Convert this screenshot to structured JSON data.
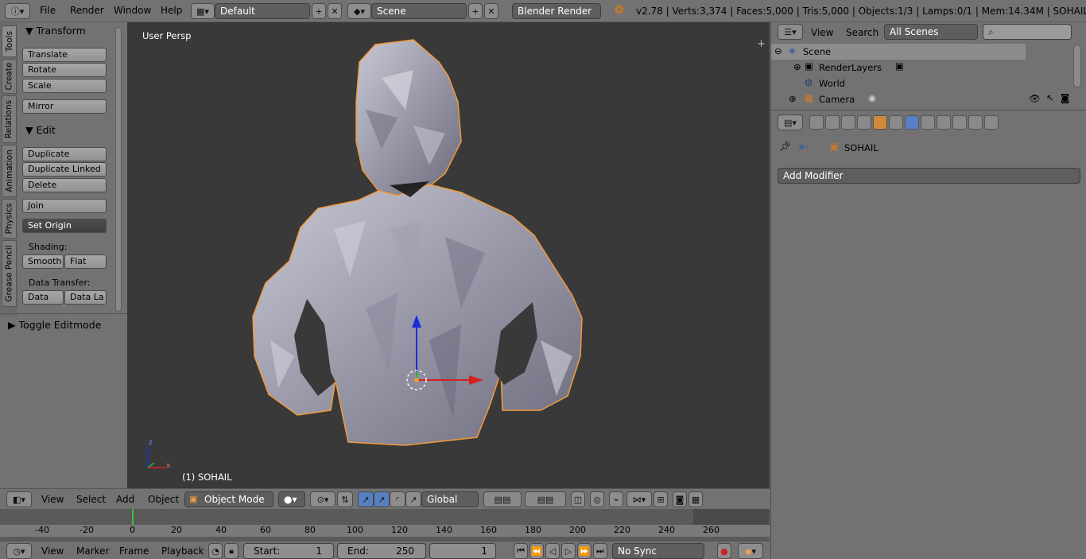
{
  "topbar": {
    "menus": [
      "File",
      "Render",
      "Window",
      "Help"
    ],
    "layout": "Default",
    "scene": "Scene",
    "engine": "Blender Render",
    "stats": "v2.78 | Verts:3,374 | Faces:5,000 | Tris:5,000 | Objects:1/3 | Lamps:0/1 | Mem:14.34M | SOHAIL"
  },
  "tabs": [
    "Tools",
    "Create",
    "Relations",
    "Animation",
    "Physics",
    "Grease Pencil"
  ],
  "shelf": {
    "transform_header": "Transform",
    "translate": "Translate",
    "rotate": "Rotate",
    "scale": "Scale",
    "mirror": "Mirror",
    "edit_header": "Edit",
    "duplicate": "Duplicate",
    "duplicate_linked": "Duplicate Linked",
    "delete": "Delete",
    "join": "Join",
    "set_origin": "Set Origin",
    "shading_label": "Shading:",
    "smooth": "Smooth",
    "flat": "Flat",
    "data_transfer_label": "Data Transfer:",
    "data": "Data",
    "data_la": "Data La",
    "toggle_editmode": "Toggle Editmode"
  },
  "viewport": {
    "label": "User Persp",
    "object_label": "(1) SOHAIL"
  },
  "view_header": {
    "menus": [
      "View",
      "Select",
      "Add",
      "Object"
    ],
    "mode": "Object Mode",
    "orientation": "Global"
  },
  "timeline": {
    "ticks": [
      "-40",
      "-20",
      "0",
      "20",
      "40",
      "60",
      "80",
      "100",
      "120",
      "140",
      "160",
      "180",
      "200",
      "220",
      "240",
      "260"
    ],
    "menus": [
      "View",
      "Marker",
      "Frame",
      "Playback"
    ],
    "start_label": "Start:",
    "start_value": "1",
    "end_label": "End:",
    "end_value": "250",
    "current_frame": "1",
    "sync": "No Sync"
  },
  "outliner": {
    "menus": [
      "View",
      "Search"
    ],
    "filter": "All Scenes",
    "items": [
      "Scene",
      "RenderLayers",
      "World",
      "Camera"
    ]
  },
  "properties": {
    "object_name": "SOHAIL",
    "add_modifier": "Add Modifier"
  },
  "colors": {
    "background": "#727272",
    "viewport": "#393939",
    "selection_outline": "#f29a3a",
    "active_tab": "#5680c2"
  }
}
